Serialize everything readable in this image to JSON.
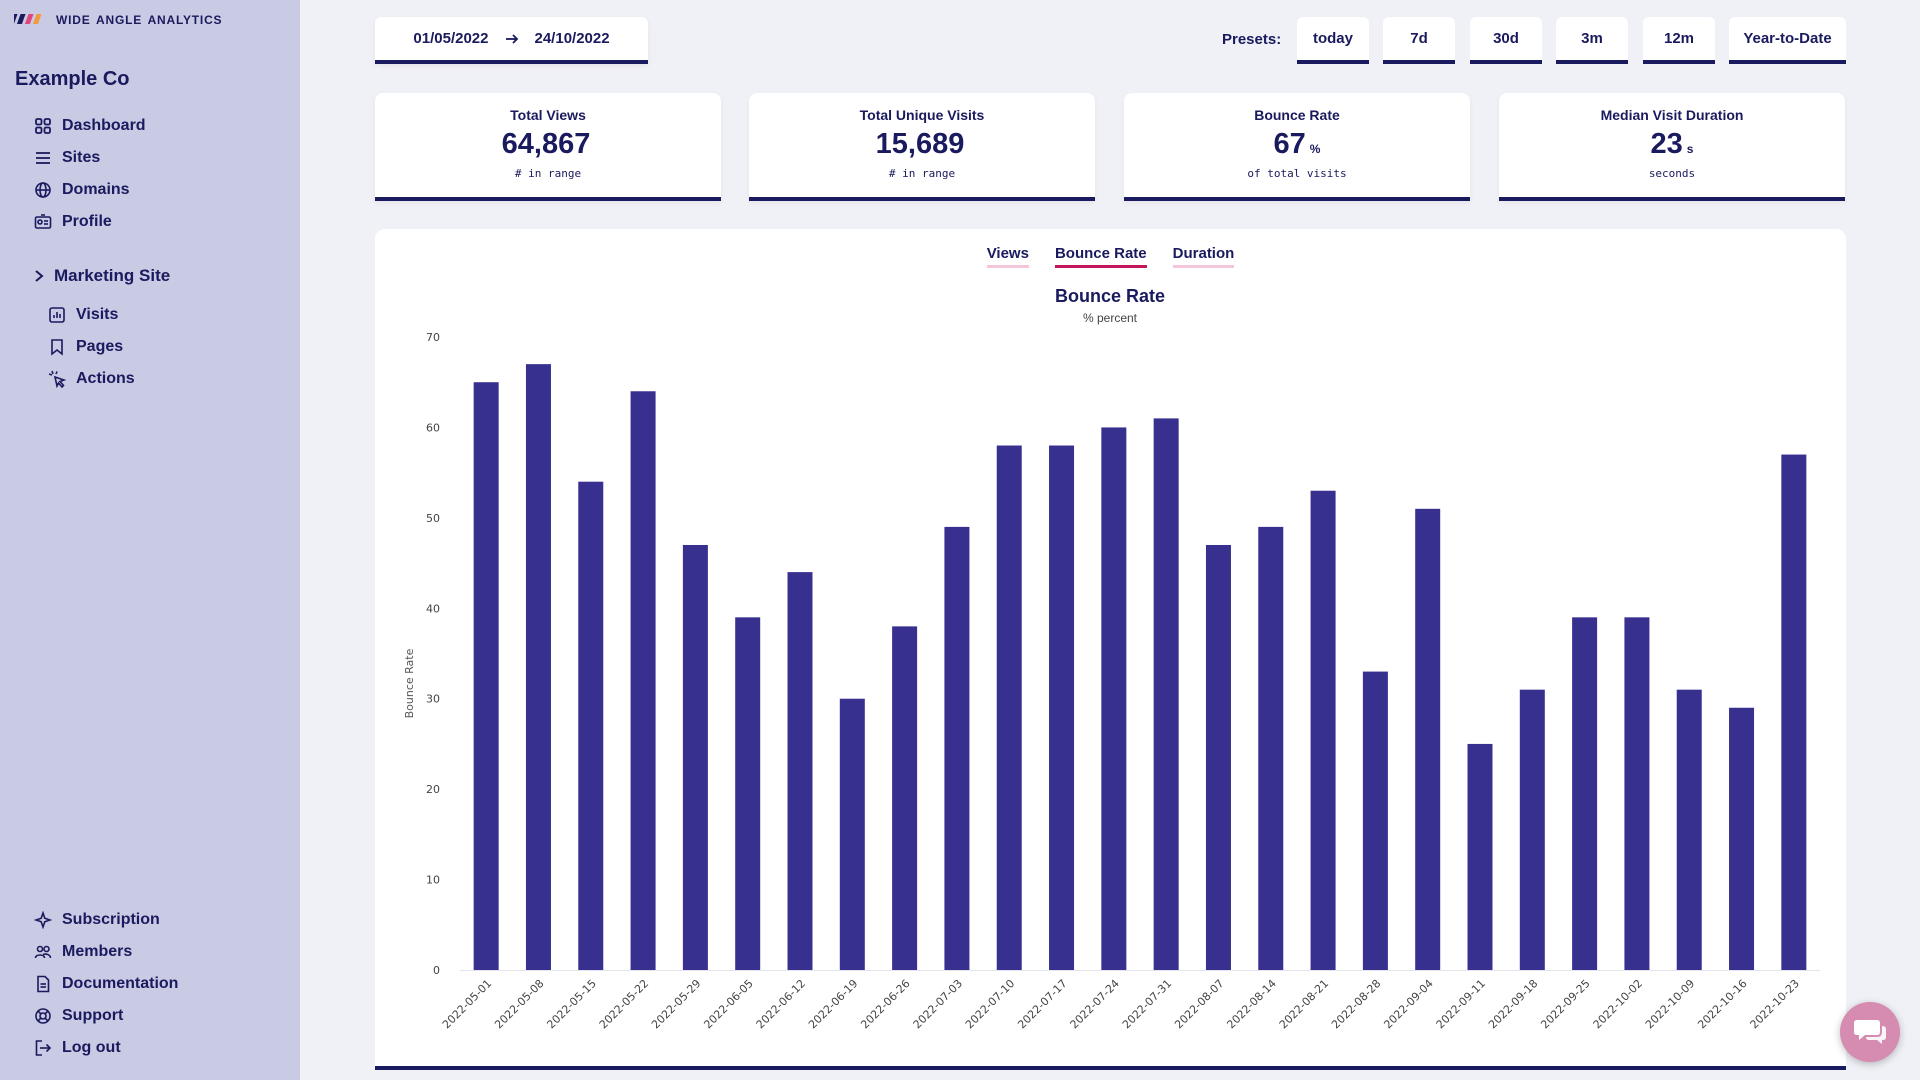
{
  "brand": {
    "name": "wide angle analytics"
  },
  "org": {
    "name": "Example Co"
  },
  "nav": {
    "main": [
      {
        "label": "Dashboard",
        "icon": "dashboard-icon"
      },
      {
        "label": "Sites",
        "icon": "list-icon"
      },
      {
        "label": "Domains",
        "icon": "globe-icon"
      },
      {
        "label": "Profile",
        "icon": "id-card-icon"
      }
    ],
    "site": {
      "name": "Marketing Site",
      "items": [
        {
          "label": "Visits",
          "icon": "chart-icon"
        },
        {
          "label": "Pages",
          "icon": "bookmark-icon"
        },
        {
          "label": "Actions",
          "icon": "click-icon"
        }
      ]
    },
    "bottom": [
      {
        "label": "Subscription",
        "icon": "sparkle-icon"
      },
      {
        "label": "Members",
        "icon": "users-icon"
      },
      {
        "label": "Documentation",
        "icon": "document-icon"
      },
      {
        "label": "Support",
        "icon": "lifebuoy-icon"
      },
      {
        "label": "Log out",
        "icon": "logout-icon"
      }
    ]
  },
  "date_range": {
    "from": "01/05/2022",
    "to": "24/10/2022"
  },
  "presets": {
    "label": "Presets:",
    "items": [
      "today",
      "7d",
      "30d",
      "3m",
      "12m",
      "Year-to-Date"
    ]
  },
  "stats": [
    {
      "title": "Total Views",
      "value": "64,867",
      "unit": "",
      "sub": "# in range"
    },
    {
      "title": "Total Unique Visits",
      "value": "15,689",
      "unit": "",
      "sub": "# in range"
    },
    {
      "title": "Bounce Rate",
      "value": "67",
      "unit": "%",
      "sub": "of total visits"
    },
    {
      "title": "Median Visit Duration",
      "value": "23",
      "unit": "s",
      "sub": "seconds"
    }
  ],
  "tabs": [
    {
      "label": "Views",
      "active": false
    },
    {
      "label": "Bounce Rate",
      "active": true
    },
    {
      "label": "Duration",
      "active": false
    }
  ],
  "colors": {
    "bar": "#38308f",
    "navy": "#1a1a5e",
    "tab_active": "#c2185b",
    "tab_inactive": "#f3c6dc",
    "chat": "#d68bb0"
  },
  "chart_data": {
    "type": "bar",
    "title": "Bounce Rate",
    "subtitle": "% percent",
    "ylabel": "Bounce Rate",
    "xlabel": "",
    "ylim": [
      0,
      70
    ],
    "yticks": [
      0,
      10,
      20,
      30,
      40,
      50,
      60,
      70
    ],
    "grid": false,
    "categories": [
      "2022-05-01",
      "2022-05-08",
      "2022-05-15",
      "2022-05-22",
      "2022-05-29",
      "2022-06-05",
      "2022-06-12",
      "2022-06-19",
      "2022-06-26",
      "2022-07-03",
      "2022-07-10",
      "2022-07-17",
      "2022-07-24",
      "2022-07-31",
      "2022-08-07",
      "2022-08-14",
      "2022-08-21",
      "2022-08-28",
      "2022-09-04",
      "2022-09-11",
      "2022-09-18",
      "2022-09-25",
      "2022-10-02",
      "2022-10-09",
      "2022-10-16",
      "2022-10-23"
    ],
    "values": [
      65,
      67,
      54,
      64,
      47,
      39,
      44,
      30,
      38,
      49,
      58,
      58,
      60,
      61,
      47,
      49,
      53,
      33,
      51,
      25,
      31,
      39,
      39,
      31,
      29,
      57
    ]
  }
}
